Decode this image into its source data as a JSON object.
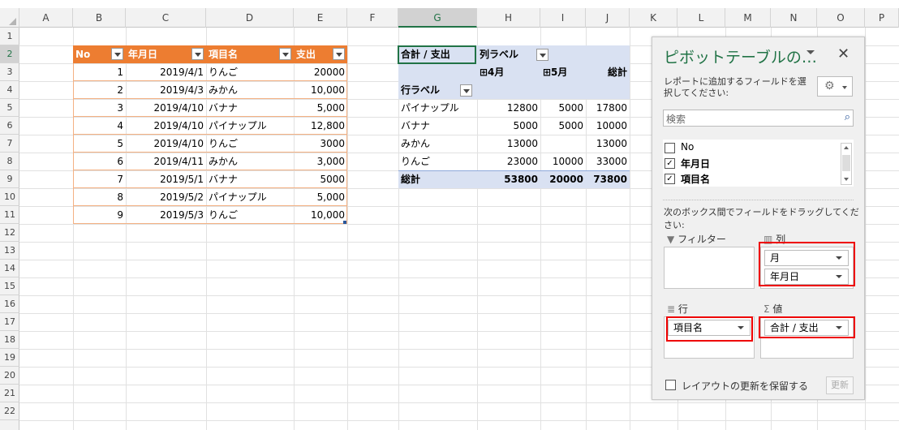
{
  "columns": [
    "A",
    "B",
    "C",
    "D",
    "E",
    "F",
    "G",
    "H",
    "I",
    "J",
    "K",
    "L",
    "M",
    "N",
    "O",
    "P"
  ],
  "rows": [
    "1",
    "2",
    "3",
    "4",
    "5",
    "6",
    "7",
    "8",
    "9",
    "10",
    "11",
    "12",
    "13",
    "14",
    "15",
    "16",
    "17",
    "18",
    "19",
    "20",
    "21",
    "22"
  ],
  "table": {
    "headers": [
      "No",
      "年月日",
      "項目名",
      "支出"
    ],
    "rows": [
      [
        "1",
        "2019/4/1",
        "りんご",
        "20000"
      ],
      [
        "2",
        "2019/4/3",
        "みかん",
        "10,000"
      ],
      [
        "3",
        "2019/4/10",
        "バナナ",
        "5,000"
      ],
      [
        "4",
        "2019/4/10",
        "パイナップル",
        "12,800"
      ],
      [
        "5",
        "2019/4/10",
        "りんご",
        "3000"
      ],
      [
        "6",
        "2019/4/11",
        "みかん",
        "3,000"
      ],
      [
        "7",
        "2019/5/1",
        "バナナ",
        "5000"
      ],
      [
        "8",
        "2019/5/2",
        "パイナップル",
        "5,000"
      ],
      [
        "9",
        "2019/5/3",
        "りんご",
        "10,000"
      ]
    ]
  },
  "pivot": {
    "value_label": "合計 / 支出",
    "col_label": "列ラベル",
    "row_label": "行ラベル",
    "col_headers": [
      "⊞4月",
      "⊞5月",
      "総計"
    ],
    "rows": [
      [
        "パイナップル",
        "12800",
        "5000",
        "17800"
      ],
      [
        "バナナ",
        "5000",
        "5000",
        "10000"
      ],
      [
        "みかん",
        "13000",
        "",
        "13000"
      ],
      [
        "りんご",
        "23000",
        "10000",
        "33000"
      ]
    ],
    "total": [
      "総計",
      "53800",
      "20000",
      "73800"
    ]
  },
  "panel": {
    "title": "ピボットテーブルの…",
    "instruction": "レポートに追加するフィールドを選択してください:",
    "search_placeholder": "検索",
    "fields": [
      {
        "label": "No",
        "checked": false
      },
      {
        "label": "年月日",
        "checked": true
      },
      {
        "label": "項目名",
        "checked": true
      }
    ],
    "drag_instruction": "次のボックス間でフィールドをドラッグしてください:",
    "areas": {
      "filter": "フィルター",
      "columns": "列",
      "rows": "行",
      "values": "値"
    },
    "column_items": [
      "月",
      "年月日"
    ],
    "row_items": [
      "項目名"
    ],
    "value_items": [
      "合計 / 支出"
    ],
    "defer_label": "レイアウトの更新を保留する",
    "update_label": "更新"
  }
}
